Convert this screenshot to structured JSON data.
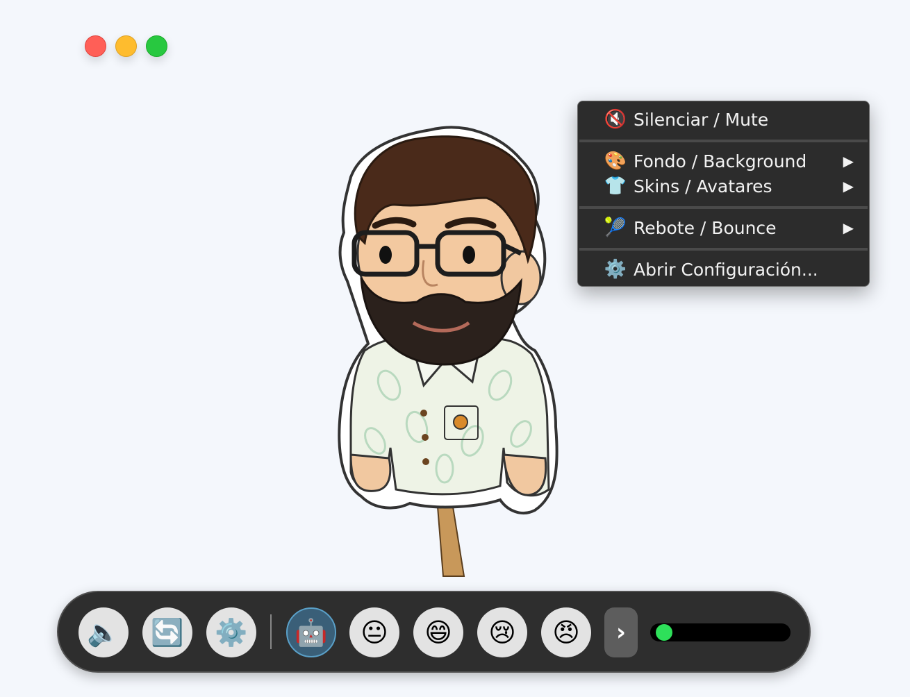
{
  "window_controls": [
    "close",
    "minimize",
    "zoom"
  ],
  "avatar": {
    "description_icon": "bearded-man-avatar-icon"
  },
  "context_menu": {
    "items": [
      {
        "icon": "🔇",
        "label": "Silenciar / Mute",
        "submenu": false
      },
      {
        "icon": "🎨",
        "label": "Fondo / Background",
        "submenu": true
      },
      {
        "icon": "👕",
        "label": "Skins / Avatares",
        "submenu": true
      },
      {
        "icon": "🎾",
        "label": "Rebote / Bounce",
        "submenu": true
      },
      {
        "icon": "⚙️",
        "label": "Abrir Configuración...",
        "submenu": false
      }
    ],
    "submenu_arrow": "▶"
  },
  "toolbar": {
    "buttons": [
      {
        "name": "speaker",
        "glyph": "🔈"
      },
      {
        "name": "refresh",
        "glyph": "🔄"
      },
      {
        "name": "settings",
        "glyph": "⚙️"
      },
      {
        "name": "robot",
        "glyph": "🤖",
        "active": true
      },
      {
        "name": "neutral",
        "glyph": "😐"
      },
      {
        "name": "happy",
        "glyph": "😄"
      },
      {
        "name": "sad",
        "glyph": "😢"
      },
      {
        "name": "angry",
        "glyph": "😠"
      }
    ],
    "more_label": "›",
    "volume_level": 0.04,
    "accent": "#2ee05a"
  }
}
